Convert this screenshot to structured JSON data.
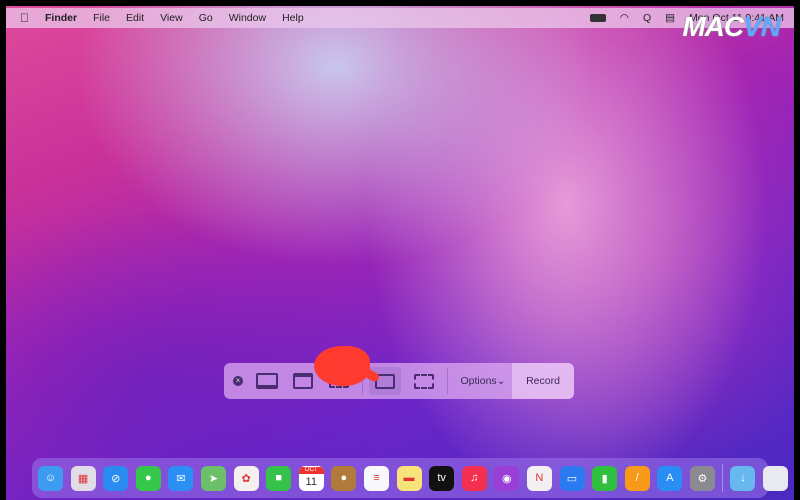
{
  "menubar": {
    "apple": "",
    "app": "Finder",
    "items": [
      "File",
      "Edit",
      "View",
      "Go",
      "Window",
      "Help"
    ],
    "clock": "Mon Oct 11 9:41 AM"
  },
  "watermark": {
    "a": "MAC",
    "b": "VN"
  },
  "toolbar": {
    "options_label": "Options",
    "options_chevron": "⌄",
    "record_label": "Record"
  },
  "dock": {
    "items": [
      {
        "name": "finder",
        "color": "#3d9bf0",
        "glyph": "☺"
      },
      {
        "name": "launchpad",
        "color": "#e0dce8",
        "glyph": "▦"
      },
      {
        "name": "safari",
        "color": "#2a8cf0",
        "glyph": "⊘"
      },
      {
        "name": "messages",
        "color": "#35c84a",
        "glyph": "●"
      },
      {
        "name": "mail",
        "color": "#2b8ff5",
        "glyph": "✉"
      },
      {
        "name": "maps",
        "color": "#6cc06a",
        "glyph": "➤"
      },
      {
        "name": "photos",
        "color": "#f4f0f0",
        "glyph": "✿"
      },
      {
        "name": "facetime",
        "color": "#34c24a",
        "glyph": "■"
      },
      {
        "name": "calendar",
        "color": "#ffffff",
        "glyph": "11",
        "month": "OCT"
      },
      {
        "name": "contacts",
        "color": "#b07a3a",
        "glyph": "●"
      },
      {
        "name": "reminders",
        "color": "#f8f8fa",
        "glyph": "≡"
      },
      {
        "name": "notes",
        "color": "#f8e27a",
        "glyph": "▬"
      },
      {
        "name": "apple-tv",
        "color": "#111111",
        "glyph": "tv"
      },
      {
        "name": "music",
        "color": "#f43050",
        "glyph": "♫"
      },
      {
        "name": "podcasts",
        "color": "#9a3ed8",
        "glyph": "◉"
      },
      {
        "name": "news",
        "color": "#f4f0f2",
        "glyph": "N"
      },
      {
        "name": "keynote",
        "color": "#2a7af0",
        "glyph": "▭"
      },
      {
        "name": "numbers",
        "color": "#2fc040",
        "glyph": "▮"
      },
      {
        "name": "pages",
        "color": "#f79a1a",
        "glyph": "/"
      },
      {
        "name": "app-store",
        "color": "#2a8cf5",
        "glyph": "A"
      },
      {
        "name": "system-preferences",
        "color": "#8a8a90",
        "glyph": "⚙"
      },
      {
        "name": "downloads-folder",
        "color": "#68b8f0",
        "glyph": "↓"
      },
      {
        "name": "trash",
        "color": "#e8eaf0",
        "glyph": ""
      }
    ]
  }
}
